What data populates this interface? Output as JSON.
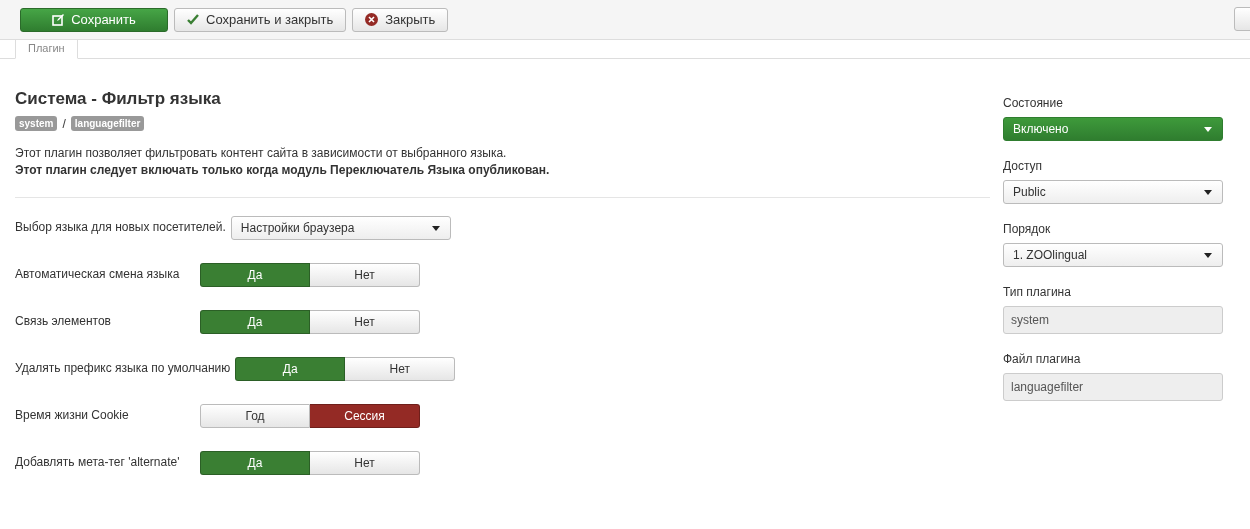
{
  "toolbar": {
    "buttons": [
      {
        "label": "Сохранить",
        "kind": "save"
      },
      {
        "label": "Сохранить и закрыть",
        "kind": "save-close"
      },
      {
        "label": "Закрыть",
        "kind": "close"
      }
    ]
  },
  "tabs": [
    {
      "label": "Плагин",
      "selected": true
    }
  ],
  "plugin": {
    "title": "Система - Фильтр языка",
    "tags": [
      "system",
      "languagefilter"
    ],
    "separator": "/",
    "description": "Этот плагин позволяет фильтровать контент сайта в зависимости от выбранного языка.",
    "note": "Этот плагин следует включать только когда модуль Переключатель Языка опубликован."
  },
  "fields": [
    {
      "kind": "select",
      "label": "Выбор языка для новых посетителей.",
      "value": "Настройки браузера"
    },
    {
      "kind": "toggle",
      "label": "Автоматическая смена языка",
      "options": [
        {
          "label": "Да",
          "selected": true,
          "color": "#3a7f33"
        },
        {
          "label": "Нет",
          "selected": false
        }
      ]
    },
    {
      "kind": "toggle",
      "label": "Связь элементов",
      "options": [
        {
          "label": "Да",
          "selected": true,
          "color": "#3a7f33"
        },
        {
          "label": "Нет",
          "selected": false
        }
      ]
    },
    {
      "kind": "toggle",
      "label": "Удалять префикс языка по умолчанию",
      "options": [
        {
          "label": "Да",
          "selected": true,
          "color": "#3a7f33"
        },
        {
          "label": "Нет",
          "selected": false
        }
      ]
    },
    {
      "kind": "toggle",
      "label": "Время жизни Cookie",
      "options": [
        {
          "label": "Год",
          "selected": false
        },
        {
          "label": "Сессия",
          "selected": true,
          "color": "#942a25"
        }
      ]
    },
    {
      "kind": "toggle",
      "label": "Добавлять мета-тег 'alternate'",
      "options": [
        {
          "label": "Да",
          "selected": true,
          "color": "#3a7f33"
        },
        {
          "label": "Нет",
          "selected": false
        }
      ]
    }
  ],
  "sidebar": [
    {
      "kind": "select",
      "label": "Состояние",
      "value": "Включено",
      "color": "#3e9a3b"
    },
    {
      "kind": "select",
      "label": "Доступ",
      "value": "Public"
    },
    {
      "kind": "select",
      "label": "Порядок",
      "value": "1. ZOOlingual"
    },
    {
      "kind": "readonly",
      "label": "Тип плагина",
      "value": "system"
    },
    {
      "kind": "readonly",
      "label": "Файл плагина",
      "value": "languagefilter"
    }
  ]
}
